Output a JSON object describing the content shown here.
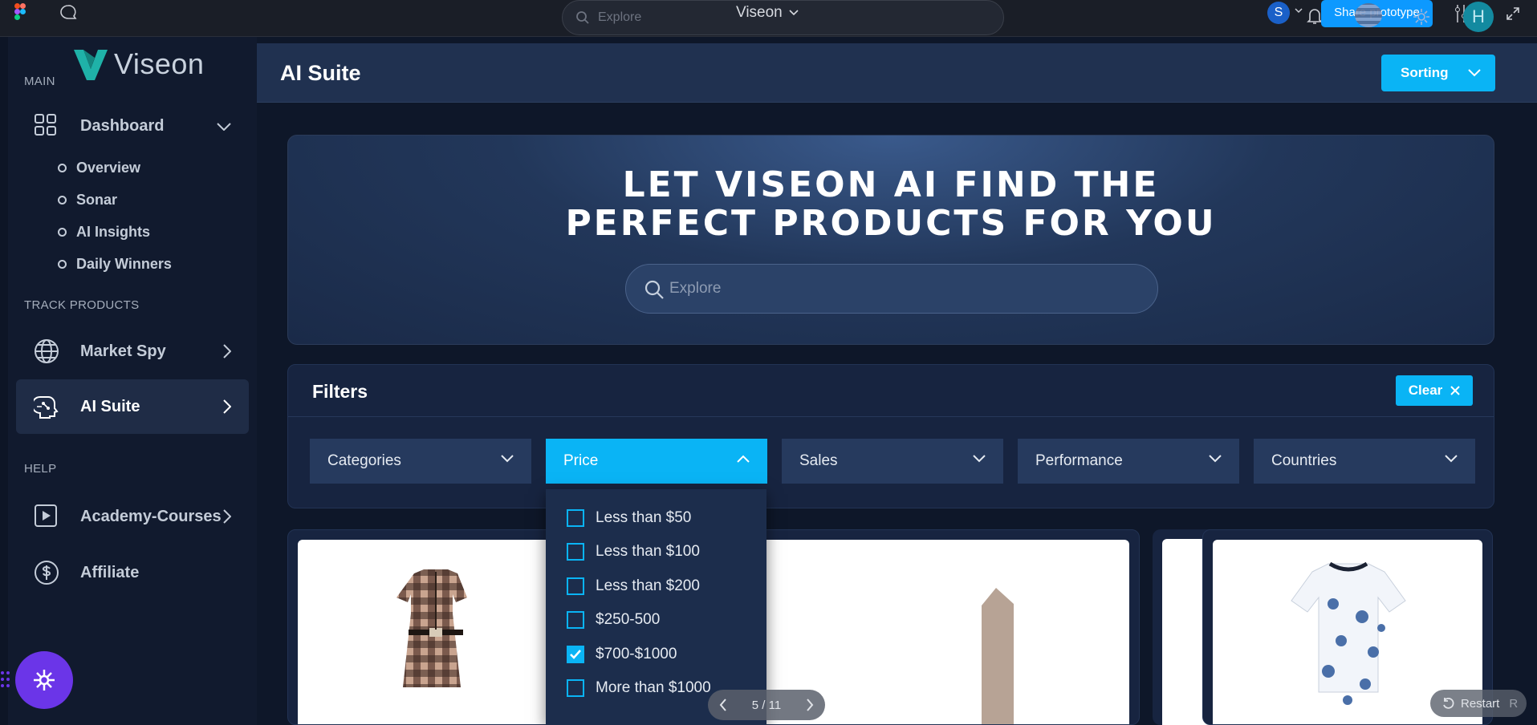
{
  "toolbar": {
    "search_placeholder": "Explore",
    "file_title": "Viseon",
    "user_initial": "S",
    "share_label": "Share prototype",
    "avatar_initials": "H"
  },
  "brand": {
    "name": "Viseon"
  },
  "sidebar": {
    "main_label": "MAIN",
    "dashboard": "Dashboard",
    "sub_items": [
      "Overview",
      "Sonar",
      "AI Insights",
      "Daily Winners"
    ],
    "track_label": "TRACK PRODUCTS",
    "market_spy": "Market Spy",
    "ai_suite": "AI Suite",
    "help_label": "HELP",
    "academy": "Academy-Courses",
    "affiliate": "Affiliate"
  },
  "header": {
    "title": "AI Suite",
    "sorting_label": "Sorting"
  },
  "hero": {
    "line1": "LET VISEON AI FIND THE",
    "line2": "PERFECT PRODUCTS FOR YOU",
    "search_placeholder": "Explore"
  },
  "filters": {
    "title": "Filters",
    "clear_label": "Clear",
    "dropdowns": [
      "Categories",
      "Price",
      "Sales",
      "Performance",
      "Countries"
    ],
    "price_options": [
      {
        "label": "Less than $50",
        "checked": false
      },
      {
        "label": "Less than $100",
        "checked": false
      },
      {
        "label": "Less than $200",
        "checked": false
      },
      {
        "label": "$250-500",
        "checked": false
      },
      {
        "label": "$700-$1000",
        "checked": true
      },
      {
        "label": "More than $1000",
        "checked": false
      }
    ]
  },
  "prototype": {
    "pager": "5 / 11",
    "restart_label": "Restart",
    "restart_key": "R"
  },
  "colors": {
    "accent": "#0ab4f5",
    "sidebar_bg": "#111a2e",
    "main_bg": "#0e1729",
    "header_bg": "#203150",
    "fab": "#6b35e8"
  }
}
